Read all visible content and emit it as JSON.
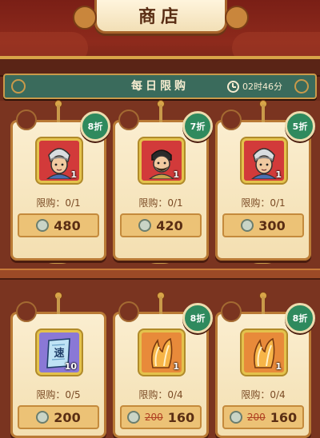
{
  "header": {
    "title": "商店"
  },
  "daily": {
    "title": "每日限购",
    "timer": "02时46分"
  },
  "items": [
    {
      "discount": "8折",
      "quantity": "1",
      "limit": "限购：0/1",
      "price": "480",
      "old_price": "",
      "frame": "red",
      "art": "grey-hair-character-portrait"
    },
    {
      "discount": "7折",
      "quantity": "1",
      "limit": "限购：0/1",
      "price": "420",
      "old_price": "",
      "frame": "red",
      "art": "bearded-character-portrait"
    },
    {
      "discount": "5折",
      "quantity": "1",
      "limit": "限购：0/1",
      "price": "300",
      "old_price": "",
      "frame": "red",
      "art": "grey-hair-character-portrait"
    },
    {
      "discount": "",
      "quantity": "10",
      "limit": "限购：0/5",
      "price": "200",
      "old_price": "",
      "frame": "purple",
      "art": "speed-scroll"
    },
    {
      "discount": "8折",
      "quantity": "1",
      "limit": "限购：0/4",
      "price": "160",
      "old_price": "200",
      "frame": "orange",
      "art": "fox-tail-token"
    },
    {
      "discount": "8折",
      "quantity": "1",
      "limit": "限购：0/4",
      "price": "160",
      "old_price": "200",
      "frame": "orange",
      "art": "fox-tail-token"
    }
  ],
  "colors": {
    "background": "#6b2c1a",
    "daily_bar": "#3a6b5c",
    "discount_badge": "#2f8a5e",
    "card": "#fbeed0",
    "price_box": "#ecc276"
  }
}
